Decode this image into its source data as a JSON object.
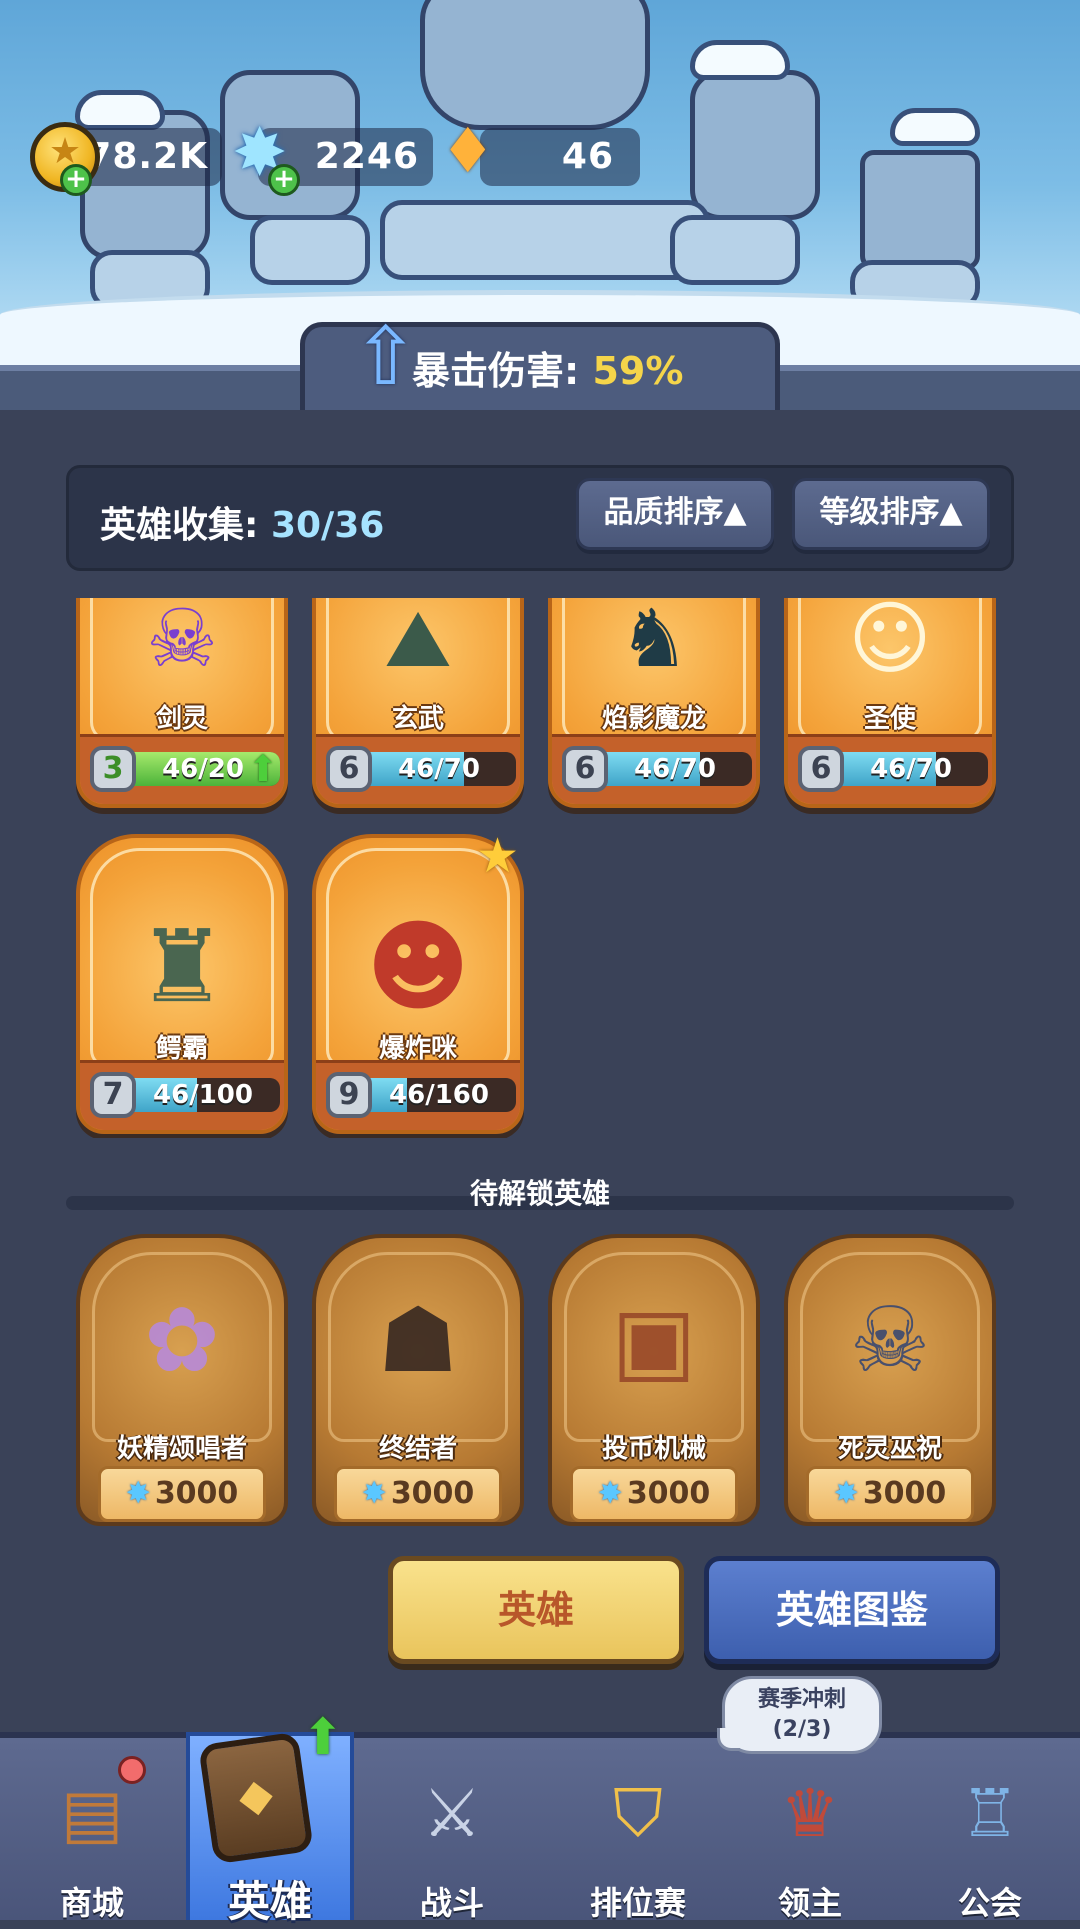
{
  "currencies": {
    "gold": "78.2K",
    "ice": "2246",
    "crystal": "46"
  },
  "crit": {
    "label": "暴击伤害:",
    "value": "59%"
  },
  "collection": {
    "label": "英雄收集:",
    "value": "30/36",
    "sort_quality": "品质排序▲",
    "sort_level": "等级排序▲"
  },
  "heroes": [
    {
      "name": "剑灵",
      "level": "3",
      "progress": "46/20",
      "fill": 1.0,
      "upgradable": true,
      "icon": "sword-spirit-hero"
    },
    {
      "name": "玄武",
      "level": "6",
      "progress": "46/70",
      "fill": 0.66,
      "upgradable": false,
      "icon": "black-tortoise-hero"
    },
    {
      "name": "焰影魔龙",
      "level": "6",
      "progress": "46/70",
      "fill": 0.66,
      "upgradable": false,
      "icon": "shadow-dragon-hero"
    },
    {
      "name": "圣使",
      "level": "6",
      "progress": "46/70",
      "fill": 0.66,
      "upgradable": false,
      "icon": "angel-hero"
    },
    {
      "name": "鳄霸",
      "level": "7",
      "progress": "46/100",
      "fill": 0.46,
      "upgradable": false,
      "icon": "crocodile-hero"
    },
    {
      "name": "爆炸咪",
      "level": "9",
      "progress": "46/160",
      "fill": 0.29,
      "upgradable": false,
      "new": true,
      "icon": "bomb-cat-hero"
    }
  ],
  "locked": {
    "title": "待解锁英雄",
    "heroes": [
      {
        "name": "妖精颂唱者",
        "price": "3000",
        "icon": "fairy-singer-hero"
      },
      {
        "name": "终结者",
        "price": "3000",
        "icon": "terminator-hero"
      },
      {
        "name": "投币机械",
        "price": "3000",
        "icon": "coin-robot-hero"
      },
      {
        "name": "死灵巫祝",
        "price": "3000",
        "icon": "necromancer-hero"
      }
    ]
  },
  "buttons": {
    "hero": "英雄",
    "codex": "英雄图鉴"
  },
  "season": {
    "title": "赛季冲刺",
    "progress": "(2/3)"
  },
  "nav": [
    {
      "label": "商城",
      "icon": "shop-chest-icon"
    },
    {
      "label": "英雄",
      "icon": "hero-card-icon",
      "active": true
    },
    {
      "label": "战斗",
      "icon": "crossed-swords-icon"
    },
    {
      "label": "排位赛",
      "icon": "ranked-shield-icon"
    },
    {
      "label": "领主",
      "icon": "lord-banner-icon"
    },
    {
      "label": "公会",
      "icon": "guild-castle-icon"
    }
  ],
  "colors": {
    "accent_gold": "#f5d54a",
    "card_orange": "#f4a33a",
    "progress_blue": "#3fa4c8",
    "progress_green": "#4cb33a",
    "nav_active": "#3e78e0"
  }
}
